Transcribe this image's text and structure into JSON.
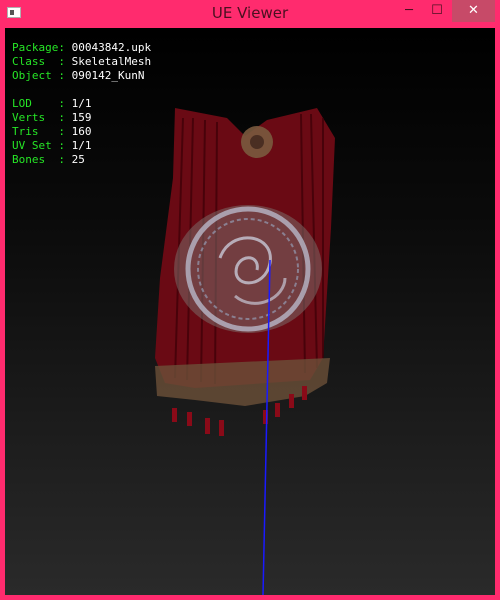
{
  "window": {
    "title": "UE Viewer",
    "minimize_glyph": "─",
    "maximize_glyph": "☐",
    "close_glyph": "✕"
  },
  "info": [
    {
      "key": "Package",
      "value": "00043842.upk"
    },
    {
      "key": "Class  ",
      "value": "SkeletalMesh"
    },
    {
      "key": "Object ",
      "value": "090142_KunN"
    },
    {
      "key": "",
      "value": ""
    },
    {
      "key": "LOD    ",
      "value": "1/1"
    },
    {
      "key": "Verts  ",
      "value": "159"
    },
    {
      "key": "Tris   ",
      "value": "160"
    },
    {
      "key": "UV Set ",
      "value": "1/1"
    },
    {
      "key": "Bones  ",
      "value": "25"
    }
  ],
  "colors": {
    "frame": "#ff2b6e",
    "info_key": "#26e626",
    "info_value": "#ffffff",
    "bone_line": "#1a1aff",
    "cloth": "#6a0a14"
  },
  "icons": {
    "app": "app-window-icon"
  }
}
